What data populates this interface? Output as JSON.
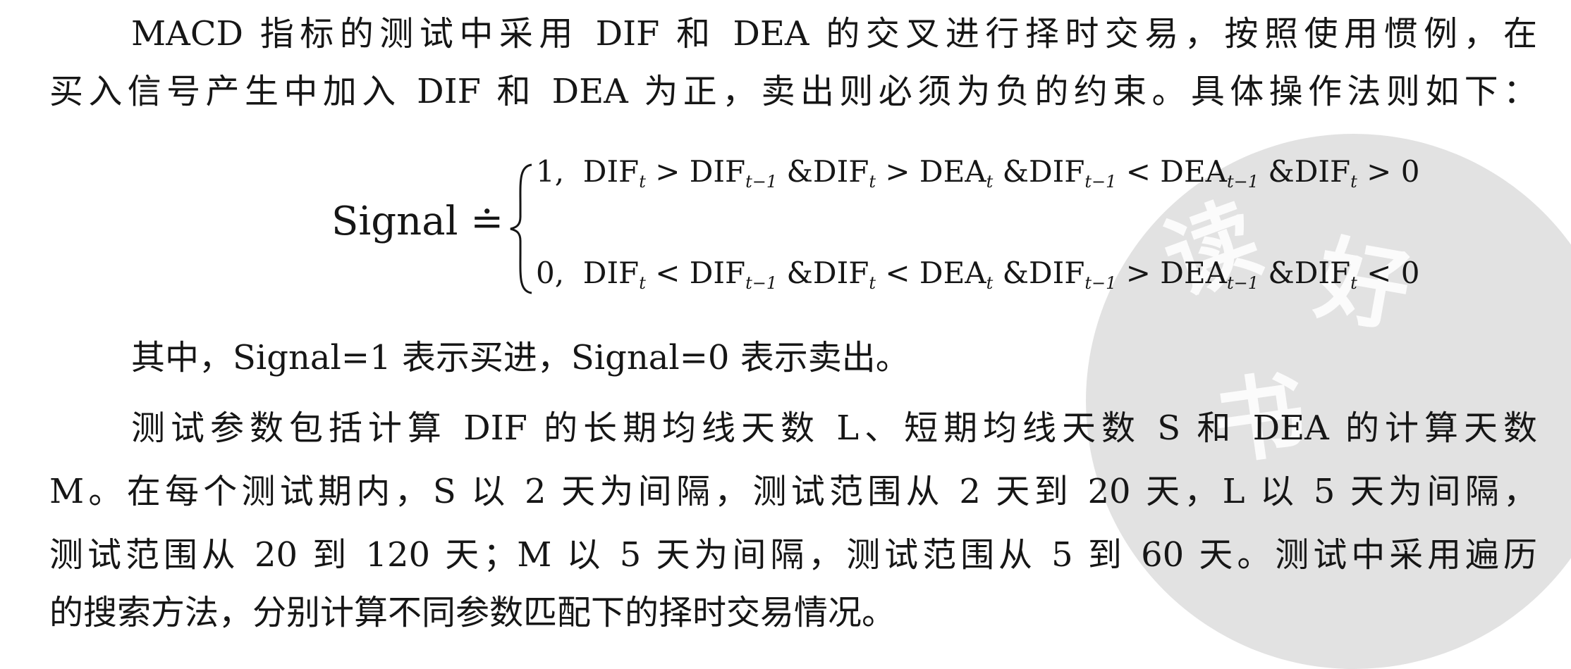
{
  "paragraph1": {
    "line1": "MACD 指标的测试中采用 DIF 和 DEA 的交叉进行择时交易，按照使用惯例，在",
    "line2": "买入信号产生中加入 DIF 和 DEA 为正，卖出则必须为负的约束。具体操作法则如下："
  },
  "formula": {
    "lhs": "Signal",
    "eq": "≐",
    "case1": {
      "value": "1,",
      "t1": "DIF",
      "s1": "t",
      "t2": " > DIF",
      "s2": "t−1",
      "t3": " &DIF",
      "s3": "t",
      "t4": " > DEA",
      "s4": "t",
      "t5": " &DIF",
      "s5": "t−1",
      "t6": " < DEA",
      "s6": "t−1",
      "t7": " &DIF",
      "s7": "t",
      "t8": " > 0"
    },
    "case2": {
      "value": "0,",
      "t1": "DIF",
      "s1": "t",
      "t2": " < DIF",
      "s2": "t−1",
      "t3": " &DIF",
      "s3": "t",
      "t4": " < DEA",
      "s4": "t",
      "t5": " &DIF",
      "s5": "t−1",
      "t6": " > DEA",
      "s6": "t−1",
      "t7": " &DIF",
      "s7": "t",
      "t8": " < 0"
    }
  },
  "note": "其中，Signal=1 表示买进，Signal=0 表示卖出。",
  "paragraph2": {
    "line1": "测试参数包括计算 DIF 的长期均线天数 L、短期均线天数 S 和 DEA 的计算天数",
    "line2": "M。在每个测试期内，S 以 2 天为间隔，测试范围从 2 天到 20 天，L 以 5 天为间隔，",
    "line3": "测试范围从 20 到 120 天；M 以 5 天为间隔，测试范围从 5 到 60 天。测试中采用遍历",
    "line4": "的搜索方法，分别计算不同参数匹配下的择时交易情况。"
  },
  "watermark": {
    "glyphs": [
      "读",
      "好",
      "书"
    ]
  }
}
